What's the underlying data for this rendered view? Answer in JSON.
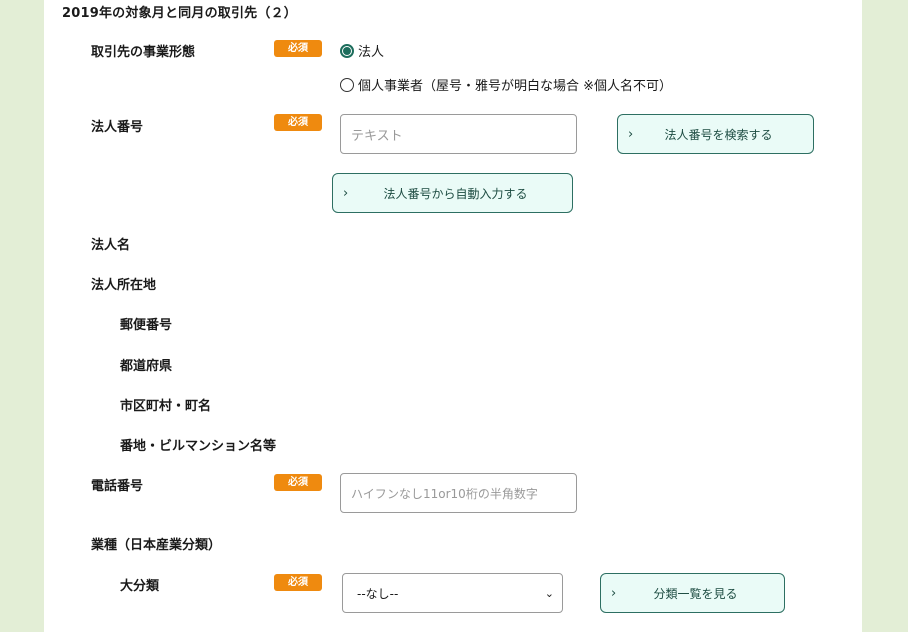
{
  "section": {
    "title": "2019年の対象月と同月の取引先（２）"
  },
  "required_badge": "必須",
  "business_type": {
    "label": "取引先の事業形態",
    "options": [
      {
        "label": "法人",
        "checked": true
      },
      {
        "label": "個人事業者（屋号・雅号が明白な場合 ※個人名不可）",
        "checked": false
      }
    ]
  },
  "corporate_number": {
    "label": "法人番号",
    "placeholder": "テキスト",
    "search_button": "法人番号を検索する",
    "autofill_button": "法人番号から自動入力する"
  },
  "corporate_name": {
    "label": "法人名"
  },
  "corporate_address": {
    "label": "法人所在地",
    "postal_code": "郵便番号",
    "prefecture": "都道府県",
    "city": "市区町村・町名",
    "street": "番地・ビルマンション名等"
  },
  "phone": {
    "label": "電話番号",
    "placeholder": "ハイフンなし11or10桁の半角数字"
  },
  "industry": {
    "label": "業種（日本産業分類）",
    "major_label": "大分類",
    "select_value": "--なし--",
    "list_button": "分類一覧を見る"
  },
  "colors": {
    "background": "#e3eed6",
    "badge": "#ef8a0f",
    "button_border": "#2d6f62",
    "button_fill": "#eafbf7",
    "radio_checked": "#1c6d5c"
  }
}
